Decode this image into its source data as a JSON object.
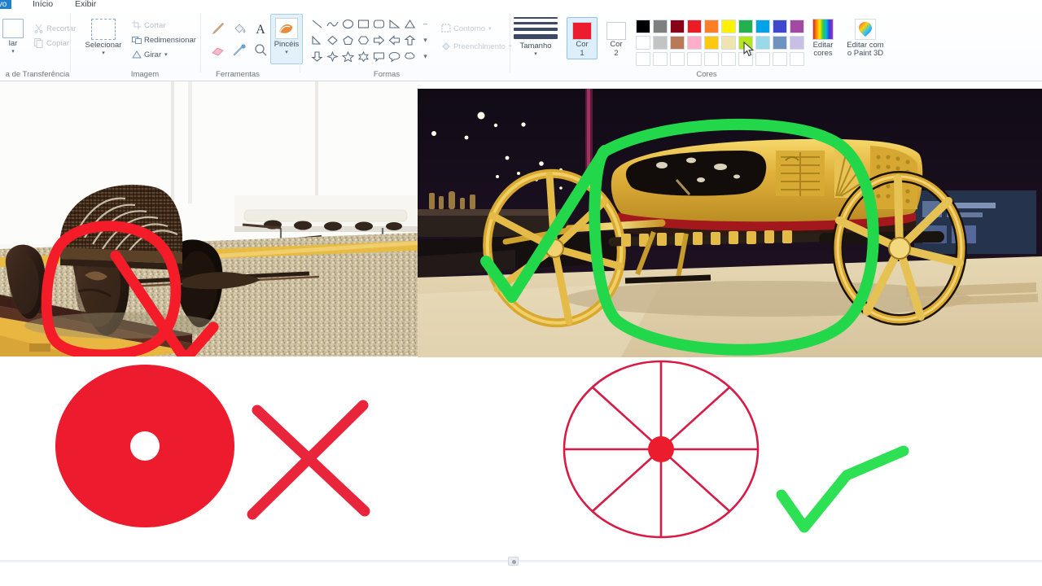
{
  "app": {
    "title": "Paint"
  },
  "ribbon": {
    "tabs": [
      {
        "id": "file",
        "label": "uivo"
      },
      {
        "id": "inicio",
        "label": "Início"
      },
      {
        "id": "exibir",
        "label": "Exibir"
      }
    ],
    "groups": {
      "clipboard": {
        "label": "a de Transferência",
        "paste_label": "lar",
        "cut_label": "Recortar",
        "copy_label": "Copiar"
      },
      "image": {
        "label": "Imagem",
        "select_label": "Selecionar",
        "crop_label": "Cortar",
        "resize_label": "Redimensionar",
        "rotate_label": "Girar"
      },
      "tools": {
        "label": "Ferramentas",
        "brushes_label": "Pincéis",
        "items": [
          "pencil-icon",
          "fill-icon",
          "text-icon",
          "eraser-icon",
          "color-picker-icon",
          "magnifier-icon"
        ]
      },
      "shapes": {
        "label": "Formas",
        "outline_label": "Contorno",
        "fill_label": "Preenchimento"
      },
      "size": {
        "label": "Tamanho"
      },
      "colors": {
        "label": "Cores",
        "color1_label_a": "Cor",
        "color1_label_b": "1",
        "color2_label_a": "Cor",
        "color2_label_b": "2",
        "color1_value": "#ed1b2e",
        "color2_value": "#ffffff",
        "edit_colors_label_a": "Editar",
        "edit_colors_label_b": "cores",
        "palette_row1": [
          "#000000",
          "#7f7f7f",
          "#880015",
          "#ed1c24",
          "#ff7f27",
          "#fff200",
          "#22b14c",
          "#00a2e8",
          "#3f48cc",
          "#a349a4"
        ],
        "palette_row2": [
          "#ffffff",
          "#c3c3c3",
          "#b97a57",
          "#ffaec9",
          "#ffc90e",
          "#efe4b0",
          "#b5e61d",
          "#99d9ea",
          "#7092be",
          "#c8bfe7"
        ],
        "palette_row3": [
          "#ffffff",
          "#ffffff",
          "#ffffff",
          "#ffffff",
          "#ffffff",
          "#ffffff",
          "#ffffff",
          "#ffffff",
          "#ffffff",
          "#ffffff"
        ]
      },
      "paint3d": {
        "label_a": "Editar com",
        "label_b": "o Paint 3D"
      }
    }
  },
  "canvas": {
    "left_photo": {
      "name": "ancient-solid-wheel-cart-photo",
      "description": "Museu: carro funerário antigo com rodas maciças de madeira",
      "annotation_color": "#f41c28",
      "annotations": [
        "red-circle",
        "red-x"
      ]
    },
    "right_photo": {
      "name": "tutankhamun-golden-chariot-photo",
      "description": "Museu: carruagem dourada egípcia com rodas de raios",
      "annotation_color": "#22d84a",
      "annotations": [
        "green-check",
        "green-circle"
      ]
    },
    "drawing_left": {
      "name": "solid-disc-wheel-drawing",
      "fill": "#ed1b2e",
      "hub": "#ffffff",
      "verdict": "x-mark",
      "verdict_color": "#e8253b"
    },
    "drawing_right": {
      "name": "spoked-wheel-drawing",
      "stroke": "#d81b45",
      "hub": "#ed1b2e",
      "spokes": 8,
      "verdict": "check-mark",
      "verdict_color": "#2ee053"
    }
  },
  "status": {
    "zoom_nub": ""
  }
}
